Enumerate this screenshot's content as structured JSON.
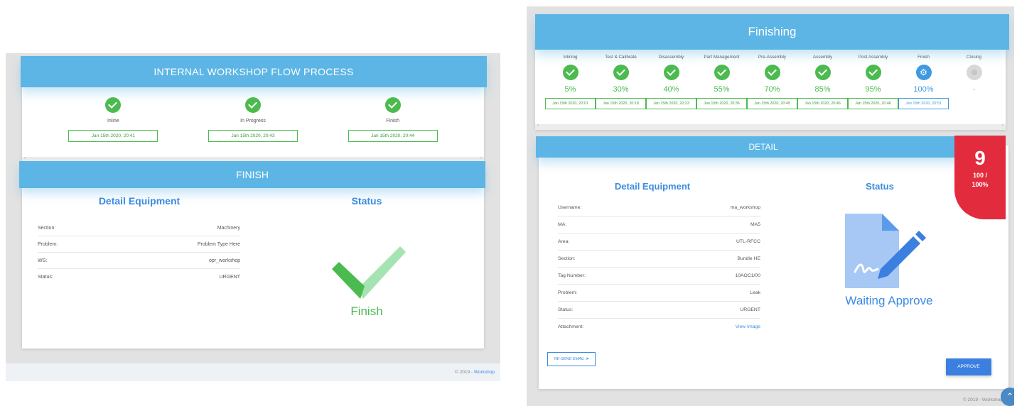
{
  "left": {
    "flow": {
      "title": "INTERNAL WORKSHOP FLOW PROCESS",
      "steps": [
        {
          "label": "Inline",
          "date": "Jan 15th 2020, 20:41"
        },
        {
          "label": "In Progress",
          "date": "Jan 15th 2020, 20:43"
        },
        {
          "label": "Finish",
          "date": "Jan 15th 2020, 20:44"
        }
      ],
      "scroll_left": "‹",
      "scroll_right": "›"
    },
    "finish": {
      "title": "FINISH",
      "detail_title": "Detail Equipment",
      "status_title": "Status",
      "rows": [
        {
          "key": "Section:",
          "value": "Machinery"
        },
        {
          "key": "Problem:",
          "value": "Problem Type Here"
        },
        {
          "key": "WS:",
          "value": "opr_workshop"
        },
        {
          "key": "Status:",
          "value": "URGENT"
        }
      ],
      "status_text": "Finish"
    },
    "footer": {
      "text": "© 2019 - ",
      "link": "Workshop"
    }
  },
  "right": {
    "stage": {
      "title": "Finishing",
      "stages": [
        {
          "label": "Inlining",
          "pct": "5%",
          "date": "Jan 15th 2020, 20:01"
        },
        {
          "label": "Test & Calibrate",
          "pct": "30%",
          "date": "Jan 15th 2020, 20:18"
        },
        {
          "label": "Disassembly",
          "pct": "40%",
          "date": "Jan 15th 2020, 20:23"
        },
        {
          "label": "Part Management",
          "pct": "55%",
          "date": "Jan 15th 2020, 20:36"
        },
        {
          "label": "Pre-Assembly",
          "pct": "70%",
          "date": "Jan 15th 2020, 20:45"
        },
        {
          "label": "Assembly",
          "pct": "85%",
          "date": "Jan 15th 2020, 20:46"
        },
        {
          "label": "Post Assembly",
          "pct": "95%",
          "date": "Jan 15th 2020, 20:46"
        },
        {
          "label": "Finish",
          "pct": "100%",
          "date": "Jan 15th 2020, 20:51"
        },
        {
          "label": "Closing",
          "pct": "-",
          "date": ""
        }
      ],
      "scroll_left": "‹",
      "scroll_right": "›"
    },
    "detail": {
      "title": "DETAIL",
      "detail_title": "Detail Equipment",
      "status_title": "Status",
      "rows": [
        {
          "key": "Username:",
          "value": "ma_workshop"
        },
        {
          "key": "MA:",
          "value": "MA5"
        },
        {
          "key": "Area:",
          "value": "UTL-RFCC"
        },
        {
          "key": "Section:",
          "value": "Bundle HE"
        },
        {
          "key": "Tag Number:",
          "value": "10AOC1/00"
        },
        {
          "key": "Problem:",
          "value": "Leak"
        },
        {
          "key": "Status:",
          "value": "URGENT"
        },
        {
          "key": "Attachment:",
          "value": "View Image"
        }
      ],
      "status_text": "Waiting Approve",
      "badge_number": "9",
      "badge_fraction_top": "100 /",
      "badge_fraction_bottom": "100%",
      "resend_label": "RE-SEND EMAIL",
      "approve_label": "APPROVE"
    },
    "footer": {
      "text": "© 2019 - Workshop"
    }
  },
  "colors": {
    "header": "#5cb5e5",
    "success": "#4cbb4f",
    "accent": "#3b8be0",
    "badge": "#e32b3e"
  }
}
